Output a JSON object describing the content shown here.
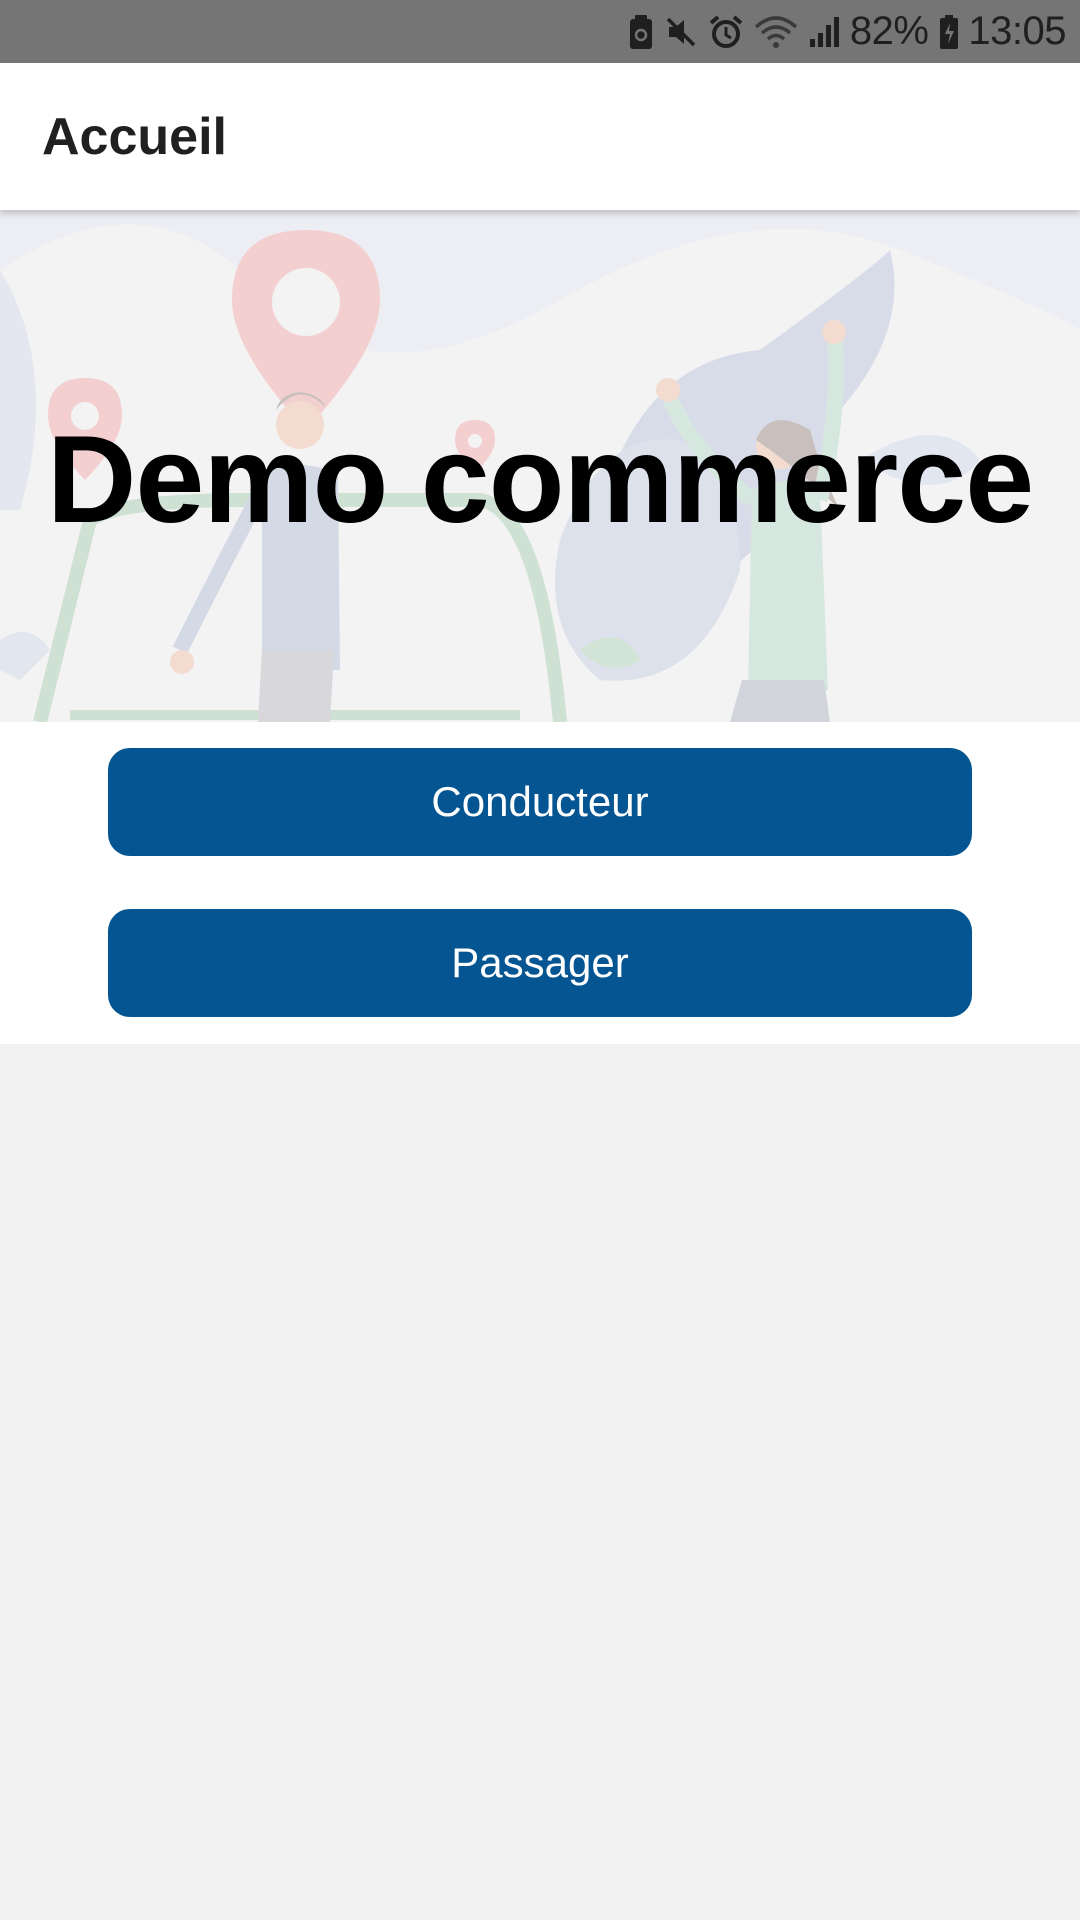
{
  "status_bar": {
    "battery_percent": "82%",
    "time": "13:05",
    "icons": [
      "storage-icon",
      "mute-icon",
      "alarm-icon",
      "wifi-icon",
      "signal-icon",
      "battery-charging-icon"
    ]
  },
  "app_bar": {
    "title": "Accueil"
  },
  "hero": {
    "title": "Demo commerce"
  },
  "actions": {
    "driver_label": "Conducteur",
    "passenger_label": "Passager"
  },
  "colors": {
    "primary": "#045592",
    "status_bar": "#757575",
    "background": "#f2f2f2"
  }
}
